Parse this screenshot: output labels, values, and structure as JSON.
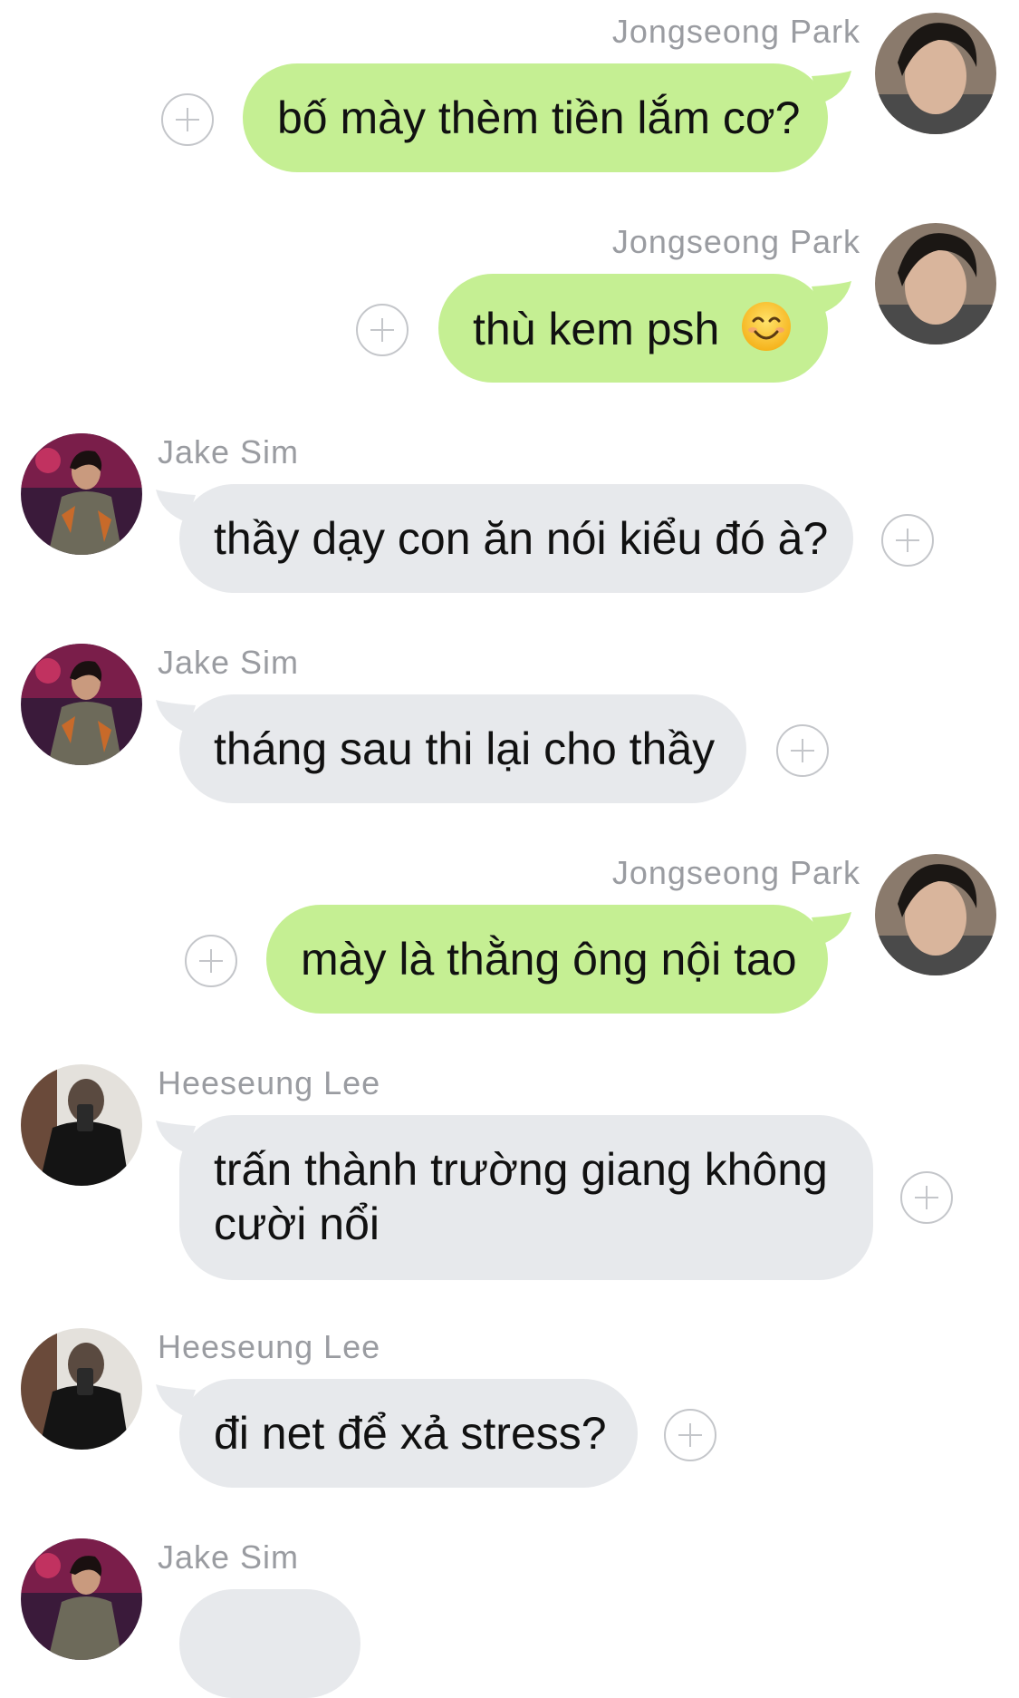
{
  "messages": [
    {
      "sender": "Jongseong Park",
      "text": "bố mày thèm tiền lắm cơ?",
      "side": "out"
    },
    {
      "sender": "Jongseong Park",
      "text": "thù kem psh",
      "emoji": "smiling-face-emoji",
      "side": "out"
    },
    {
      "sender": "Jake Sim",
      "text": "thầy dạy con ăn nói kiểu đó à?",
      "side": "in"
    },
    {
      "sender": "Jake Sim",
      "text": "tháng sau thi lại cho thầy",
      "side": "in"
    },
    {
      "sender": "Jongseong Park",
      "text": "mày là thằng ông nội tao",
      "side": "out"
    },
    {
      "sender": "Heeseung Lee",
      "text": "trấn thành trường giang không cười nổi",
      "side": "in"
    },
    {
      "sender": "Heeseung Lee",
      "text": "đi net để xả stress?",
      "side": "in"
    },
    {
      "sender": "Jake Sim",
      "text": "",
      "side": "in"
    }
  ],
  "colors": {
    "outgoing_bubble": "#c5ef93",
    "incoming_bubble": "#e7e9ec",
    "sender_name": "#9a9ca1",
    "add_icon": "#c4c6ca"
  }
}
